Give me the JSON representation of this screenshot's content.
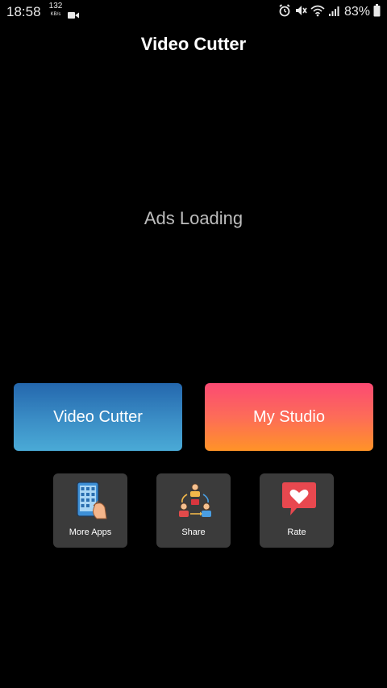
{
  "status_bar": {
    "time": "18:58",
    "net_speed": "132",
    "net_speed_unit": "KB/s",
    "battery_percent": "83%"
  },
  "header": {
    "title": "Video Cutter"
  },
  "ad": {
    "text": "Ads Loading"
  },
  "main_buttons": {
    "video_cutter": "Video Cutter",
    "my_studio": "My Studio"
  },
  "tiles": {
    "more_apps": "More Apps",
    "share": "Share",
    "rate": "Rate"
  },
  "colors": {
    "background": "#000000",
    "video_cutter_gradient": [
      "#2467ad",
      "#4aaad6"
    ],
    "my_studio_gradient": [
      "#fb4a73",
      "#ff9327"
    ],
    "tile_bg": "#3b3b3b"
  }
}
